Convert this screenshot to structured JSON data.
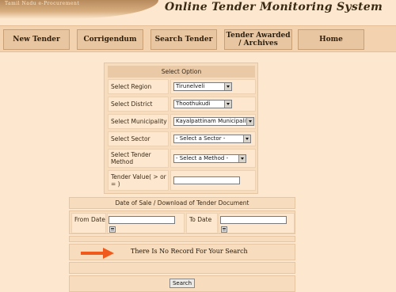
{
  "header": {
    "banner_text": "Tamil Nadu e-Procurement",
    "title": "Online Tender Monitoring System"
  },
  "nav": {
    "items": [
      {
        "label": "New Tender"
      },
      {
        "label": "Corrigendum"
      },
      {
        "label": "Search Tender"
      },
      {
        "label": "Tender Awarded / Archives"
      },
      {
        "label": "Home"
      }
    ]
  },
  "form": {
    "heading": "Select Option",
    "region_label": "Select Region",
    "region_value": "Tirunelveli",
    "district_label": "Select District",
    "district_value": "Thoothukudi",
    "municipality_label": "Select Municipality",
    "municipality_value": "Kayalpattinam Municipality",
    "sector_label": "Select Sector",
    "sector_value": "- Select a Sector -",
    "method_label": "Select Tender Method",
    "method_value": "- Select a Method -",
    "value_label": "Tender Value( > or = )",
    "value_input": ""
  },
  "date_section": {
    "heading": "Date of Sale / Download of Tender Document",
    "from_label": "From Date",
    "from_value": "",
    "to_label": "To Date",
    "to_value": ""
  },
  "result": {
    "message": "There Is No Record For Your Search"
  },
  "search_button": "Search",
  "colors": {
    "background": "#fde8cf",
    "arrow": "#f05a1c"
  }
}
